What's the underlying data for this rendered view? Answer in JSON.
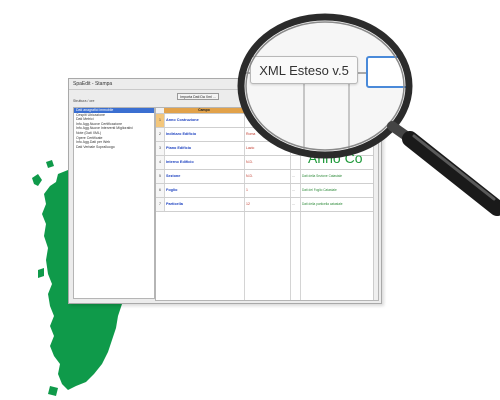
{
  "window": {
    "title": "SpaEdit - Stampa",
    "import_button": "Importa Dati Da Xml ...",
    "tree_caption": "Struttura / ore",
    "tree_items": [
      "Dati anagrafici immobile",
      "Cespiti Ubicazione",
      "Dati Metrici",
      "Info Agg.Nuove Certificazione",
      "Info Agg.Nuove Interventi Migliorativi",
      "Note (Dati XML)",
      "Opere Certificate",
      "Info Agg.Dati per Web",
      "Dati Verbale Sopralluogo"
    ],
    "grid_header": "Campo",
    "rows": [
      {
        "num": "1",
        "name": "Anno Costruzione",
        "value": "",
        "dots": "",
        "desc": ""
      },
      {
        "num": "2",
        "name": "Indirizzo Edificio",
        "value": "Roma",
        "dots": "",
        "desc": ""
      },
      {
        "num": "3",
        "name": "Piano Edificio",
        "value": "Lazio",
        "dots": "",
        "desc": ""
      },
      {
        "num": "4",
        "name": "Interno Edificio",
        "value": "N.D.",
        "dots": "",
        "desc": ""
      },
      {
        "num": "5",
        "name": "Sezione",
        "value": "N.D.",
        "dots": "...",
        "desc": "Dati della Sezione Catastale"
      },
      {
        "num": "6",
        "name": "Foglio",
        "value": "1",
        "dots": "...",
        "desc": "Dati del Foglio Catastale"
      },
      {
        "num": "7",
        "name": "Particella",
        "value": "12",
        "dots": "...",
        "desc": "Dati della particella catastale"
      }
    ]
  },
  "magnifier": {
    "button_label": "XML Esteso v.5",
    "overlay_text": "Anno Co"
  },
  "colors": {
    "sardinia_green": "#0f9a4a",
    "accent_orange": "#e2a24a",
    "field_label_blue": "#1a3fbf",
    "desc_green": "#2e8b3a",
    "lens_field_border": "#4a8ad9"
  },
  "icons": {
    "map": "sardinia-map-icon",
    "magnifier": "magnifying-glass-icon"
  }
}
